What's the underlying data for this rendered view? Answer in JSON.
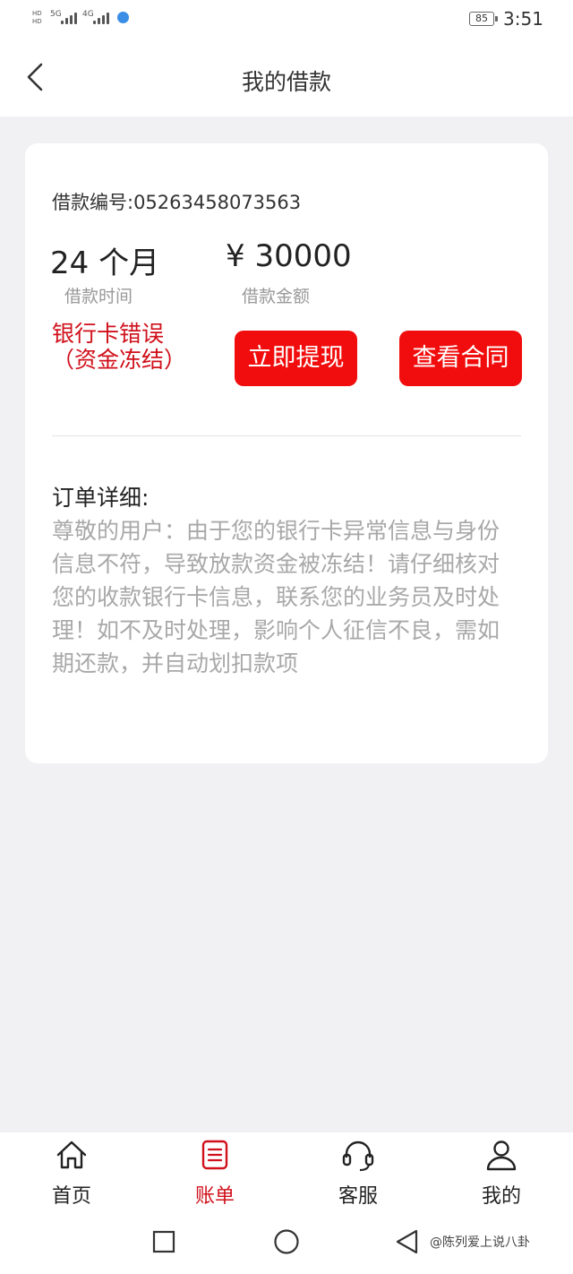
{
  "status_bar": {
    "sim1_tag": "5G",
    "sim2_tag": "4G",
    "hd_tag": "HD",
    "battery": "85",
    "time": "3:51"
  },
  "nav": {
    "title": "我的借款"
  },
  "loan": {
    "number_label": "借款编号:05263458073563",
    "term_value": "24 个月",
    "term_label": "借款时间",
    "amount_value": "¥ 30000",
    "amount_label": "借款金额",
    "status": "银行卡错误（资金冻结）",
    "withdraw_label": "立即提现",
    "contract_label": "查看合同"
  },
  "detail": {
    "title": "订单详细:",
    "body": "尊敬的用户：由于您的银行卡异常信息与身份信息不符，导致放款资金被冻结！请仔细核对您的收款银行卡信息，联系您的业务员及时处理！如不及时处理，影响个人征信不良，需如期还款，并自动划扣款项"
  },
  "tabs": [
    {
      "label": "首页",
      "icon": "home-icon"
    },
    {
      "label": "账单",
      "icon": "bill-icon",
      "active": true
    },
    {
      "label": "客服",
      "icon": "headset-icon"
    },
    {
      "label": "我的",
      "icon": "user-icon"
    }
  ],
  "colors": {
    "accent": "#f10d0d",
    "status_red": "#d0101b",
    "muted_text": "#a8a8a8",
    "background": "#f1f1f3"
  },
  "watermark": "@陈列爱上说八卦"
}
